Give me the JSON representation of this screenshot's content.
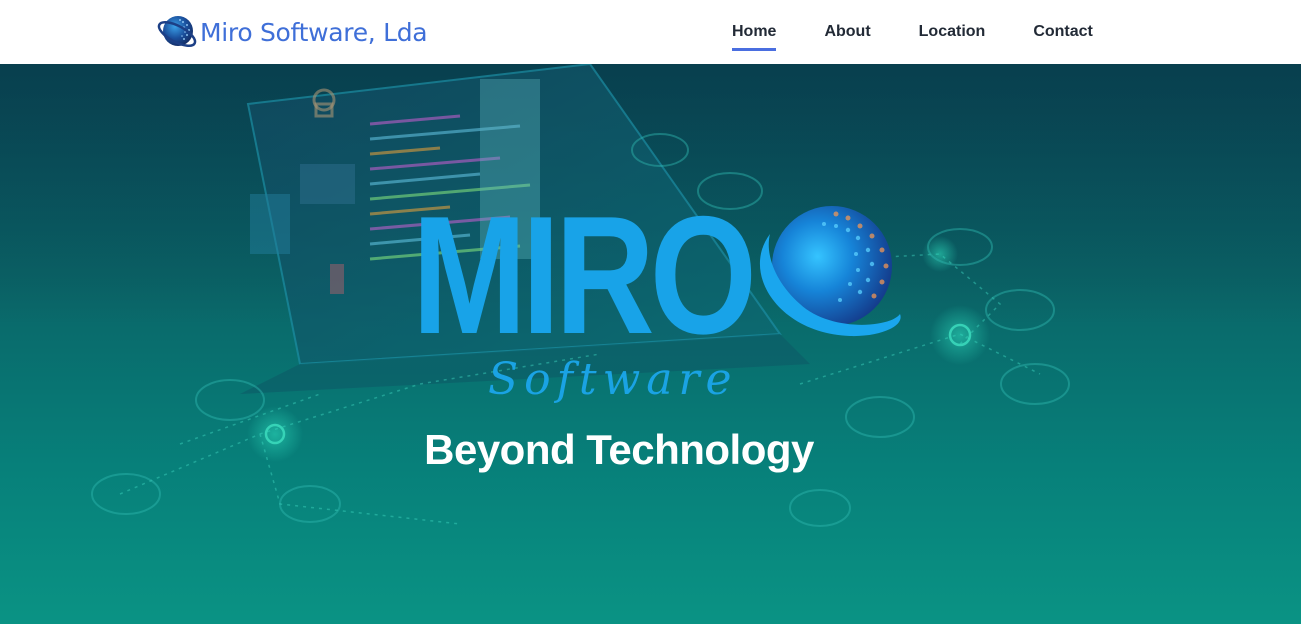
{
  "header": {
    "brand_name": "Miro Software, Lda",
    "brand_color": "#3f6fd8",
    "logo_icon": "globe-icon",
    "nav": [
      {
        "label": "Home",
        "active": true
      },
      {
        "label": "About",
        "active": false
      },
      {
        "label": "Location",
        "active": false
      },
      {
        "label": "Contact",
        "active": false
      }
    ],
    "active_indicator_color": "#4a6ee0"
  },
  "hero": {
    "logo_word": "MIRO",
    "logo_subword": "Software",
    "logo_color": "#18a3e8",
    "tagline": "Beyond Technology",
    "background_colors": [
      "#0b5362",
      "#0a9384"
    ],
    "background_image": "laptop-network-illustration"
  }
}
